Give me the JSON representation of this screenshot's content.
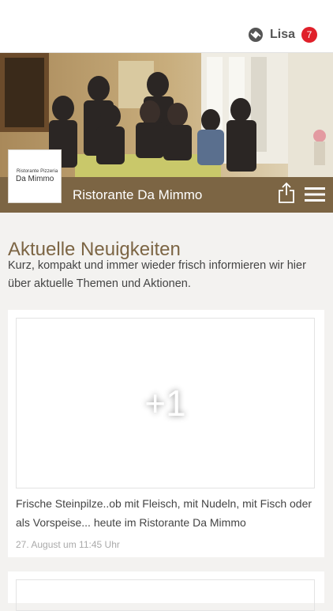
{
  "header": {
    "user_name": "Lisa",
    "notification_count": "7",
    "brand_icon": "pin-logo-icon"
  },
  "restaurant": {
    "title": "Ristorante Da Mimmo",
    "logo_small": "Ristorante Pizzeria",
    "logo_main": "Da Mimmo",
    "cover_photo": "team-photo"
  },
  "icons": {
    "share": "share-icon",
    "menu": "hamburger-menu-icon"
  },
  "news": {
    "heading": "Aktuelle Neuigkeiten",
    "intro": "Kurz, kompakt und immer wieder frisch informieren wir hier über aktuelle Themen und Aktionen.",
    "posts": [
      {
        "image_overlay": "+1",
        "text": "Frische Steinpilze..ob mit Fleisch, mit Nudeln, mit Fisch oder als Vorspeise... heute im Ristorante Da Mimmo",
        "date": "27. August um 11:45 Uhr"
      }
    ]
  },
  "colors": {
    "brand_brown": "#7c6544",
    "badge_red": "#e0202a",
    "background": "#f3f2f0"
  }
}
